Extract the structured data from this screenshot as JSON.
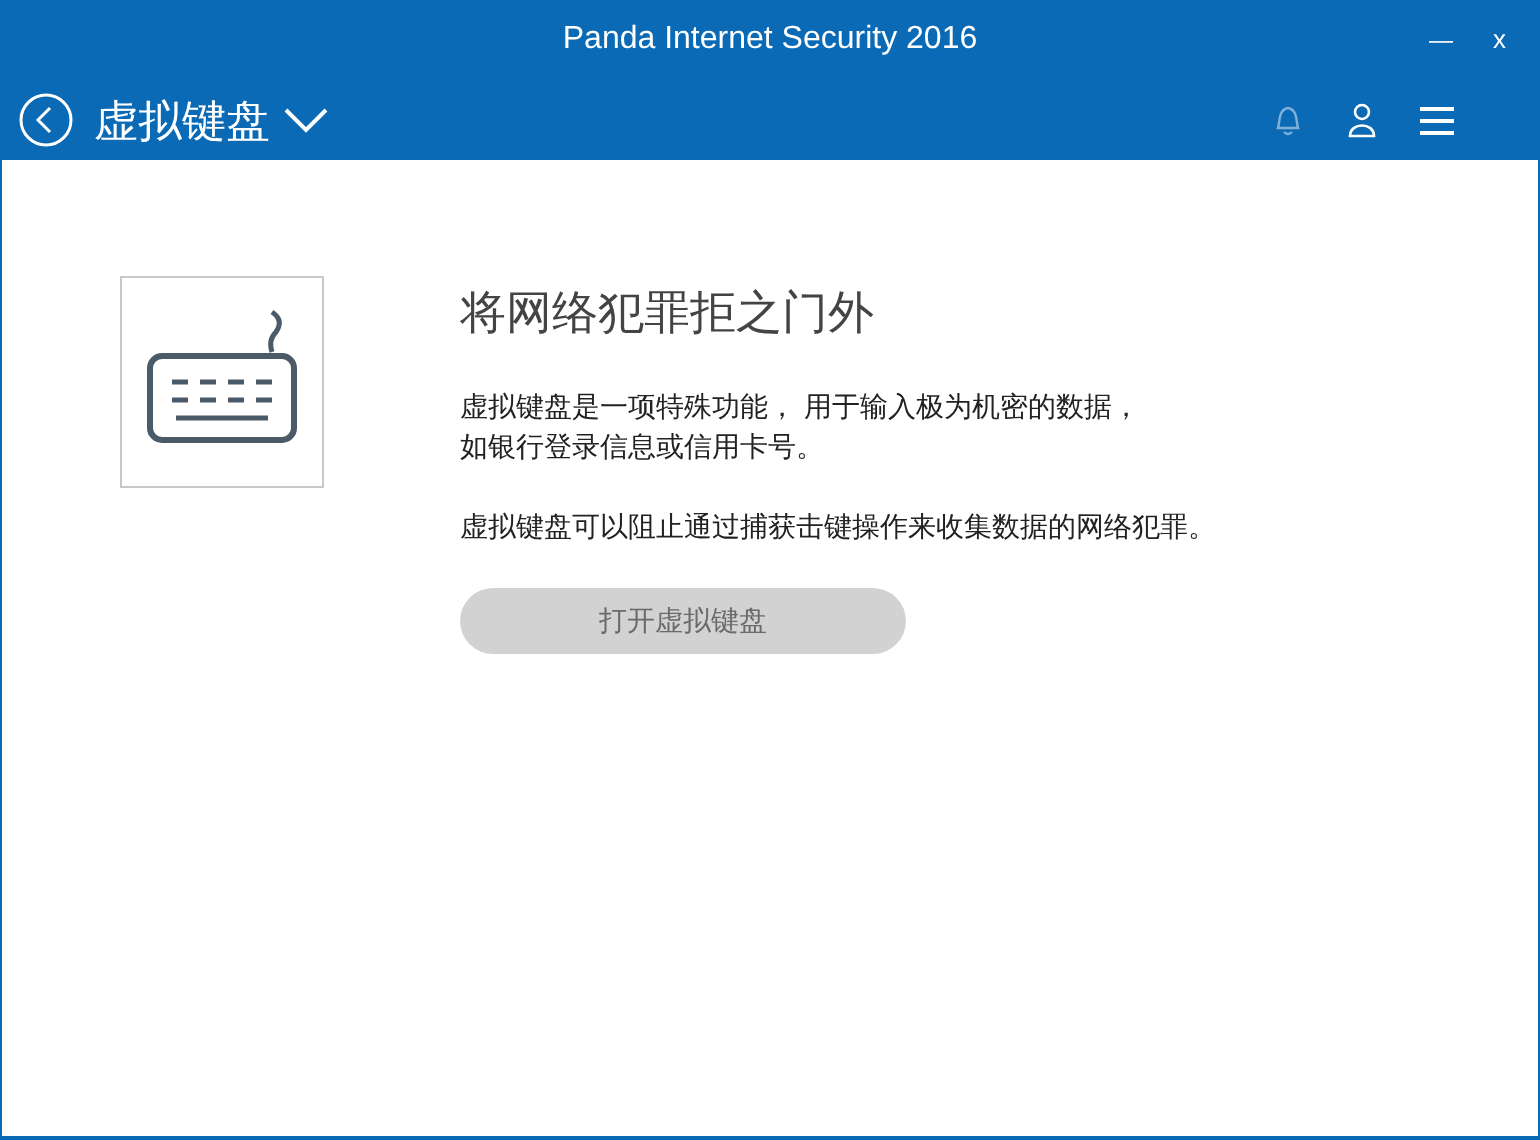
{
  "window": {
    "title": "Panda Internet Security 2016",
    "controls": [
      "—",
      "x"
    ]
  },
  "header": {
    "title": "虚拟键盘"
  },
  "content": {
    "heading": "将网络犯罪拒之门外",
    "paragraphs": [
      [
        "虚拟键盘是一项特殊功能， 用于输入极为机密的数据，",
        "如银行登录信息或信用卡号。"
      ],
      [
        "虚拟键盘可以阻止通过捕获击键操作来收集数据的网络犯罪。"
      ]
    ],
    "button": {
      "label": "打开虚拟键盘",
      "disabled": true
    }
  }
}
